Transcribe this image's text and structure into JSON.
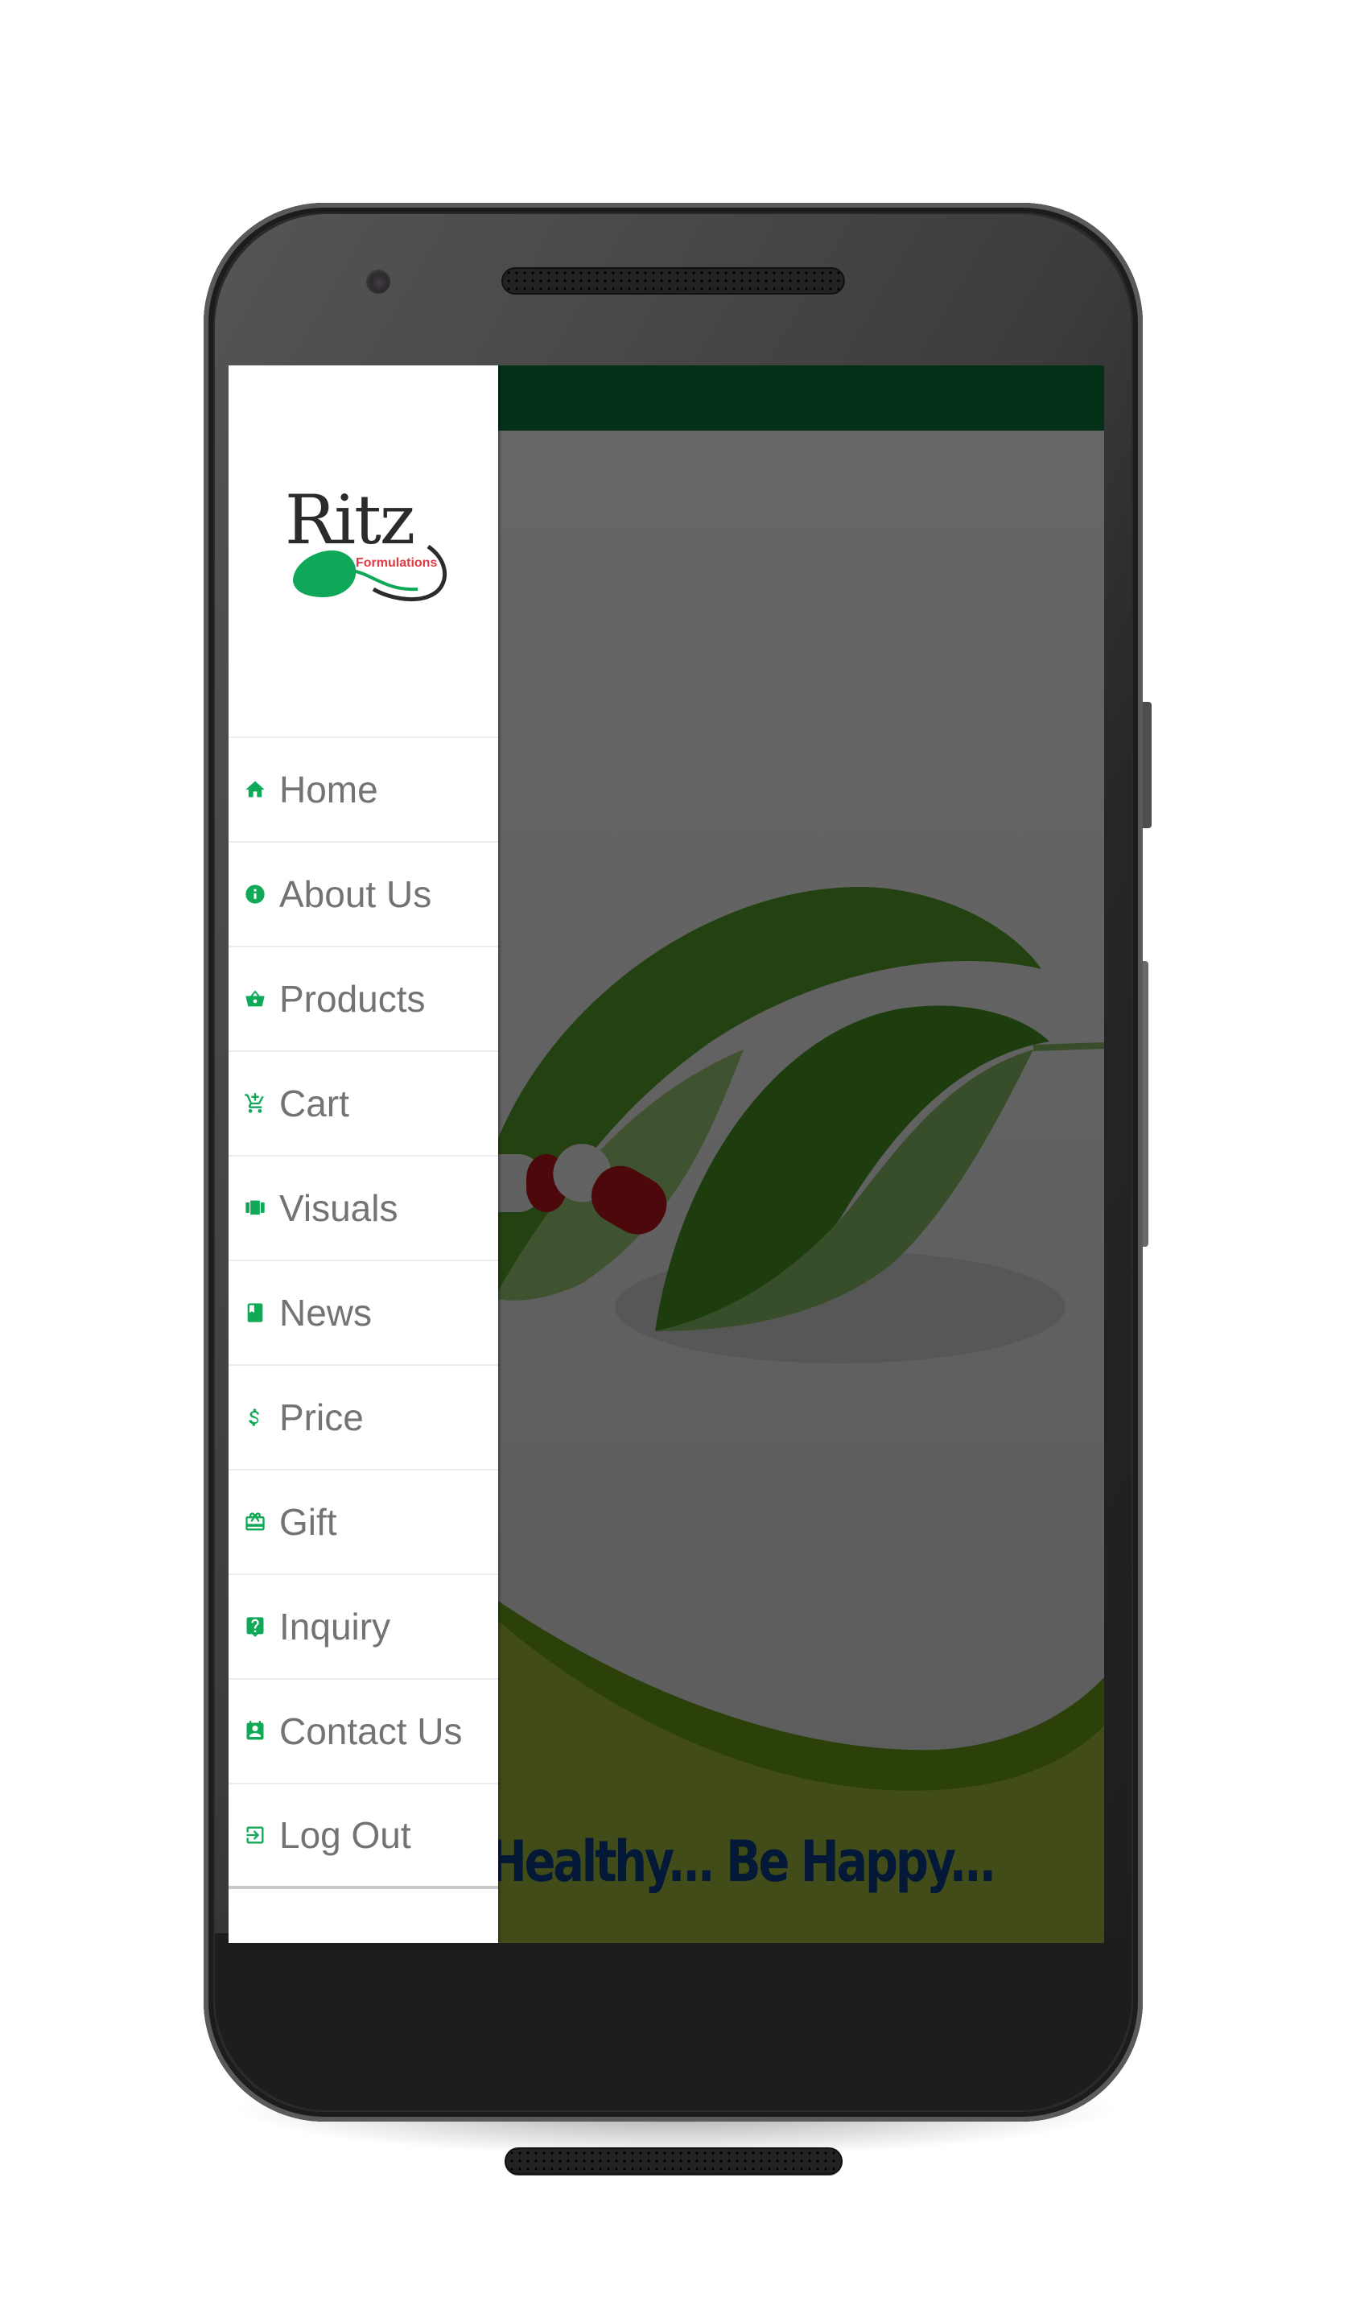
{
  "app": {
    "name": "Ritz Formulations",
    "brand_colors": {
      "primary_green": "#067a3a",
      "icon_green": "#0fa958",
      "tagline_blue": "#0b3f8c",
      "logo_red": "#e03a44"
    }
  },
  "drawer": {
    "logo": {
      "title": "Ritz",
      "subtitle": "Formulations"
    },
    "items": [
      {
        "label": "Home",
        "icon": "home-icon"
      },
      {
        "label": "About Us",
        "icon": "info-icon"
      },
      {
        "label": "Products",
        "icon": "basket-icon"
      },
      {
        "label": "Cart",
        "icon": "cart-add-icon"
      },
      {
        "label": "Visuals",
        "icon": "carousel-icon"
      },
      {
        "label": "News",
        "icon": "book-icon"
      },
      {
        "label": "Price",
        "icon": "dollar-icon"
      },
      {
        "label": "Gift",
        "icon": "gift-card-icon"
      },
      {
        "label": "Inquiry",
        "icon": "help-box-icon"
      },
      {
        "label": "Contact Us",
        "icon": "contact-card-icon"
      },
      {
        "label": "Log Out",
        "icon": "logout-icon"
      }
    ]
  },
  "main": {
    "tagline": "Be Healthy... Be Happy..."
  }
}
